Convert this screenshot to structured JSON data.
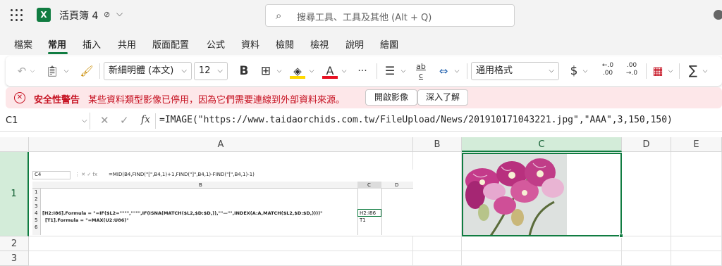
{
  "titlebar": {
    "title": "活頁簿 4",
    "search_placeholder": "搜尋工具、工具及其他 (Alt + Q)",
    "app_letter": "X"
  },
  "tabs": [
    "檔案",
    "常用",
    "插入",
    "共用",
    "版面配置",
    "公式",
    "資料",
    "檢閱",
    "檢視",
    "說明",
    "繪圖"
  ],
  "ribbon": {
    "font_name": "新細明體 (本文)",
    "font_size": "12",
    "bold": "B",
    "number_format": "通用格式",
    "currency": "$",
    "inc_decimal": "←.0",
    "inc_decimal2": ".00",
    "dec_decimal": ".00",
    "dec_decimal2": "→.0",
    "more": "···",
    "sigma": "∑",
    "abc": "ab",
    "abc2": "c"
  },
  "warning": {
    "title": "安全性警告",
    "message": "某些資料類型影像已停用，因為它們需要連線到外部資料來源。",
    "enable_button": "開啟影像",
    "learn_button": "深入了解"
  },
  "formula_bar": {
    "name_box": "C1",
    "fx": "fx",
    "formula": "=IMAGE(\"https://www.taidaorchids.com.tw/FileUpload/News/201910171043221.jpg\",\"AAA\",3,150,150)"
  },
  "columns": [
    "A",
    "B",
    "C",
    "D",
    "E"
  ],
  "rows": [
    "1",
    "2",
    "3"
  ],
  "embedded": {
    "name_box": "C4",
    "formula": "=MID(B4,FIND(\"[\",B4,1)+1,FIND(\"]\",B4,1)-FIND(\"[\",B4,1)-1)",
    "columns": [
      "B",
      "C",
      "D"
    ],
    "rows": [
      "1",
      "2",
      "3",
      "4",
      "5",
      "6"
    ],
    "b4": "[H2:I86].Formula = \"=IF($L2=\"\"\"\",\"\"\"\",IF(ISNA(MATCH($L2,$D:$D,)),\"\"—\"\",INDEX(A:A,MATCH($L2,$D:$D,))))\"",
    "c4": "H2:I86",
    "b5": "[T1].Formula = \"=MAX(U2:U86)\"",
    "c5": "T1"
  },
  "colors": {
    "accent": "#107c41",
    "warning_text": "#c50f1f",
    "warning_bg": "#fde7e9"
  }
}
